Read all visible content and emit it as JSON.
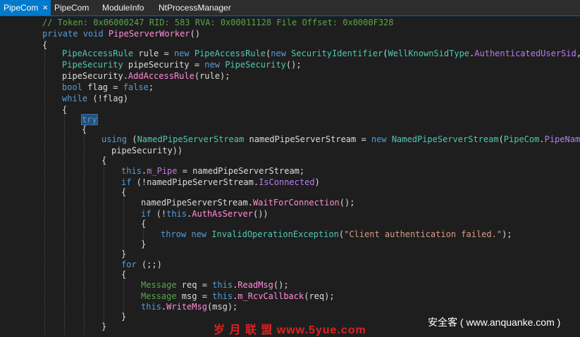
{
  "tabs": [
    {
      "label": "PipeCom",
      "active": true,
      "close": "×"
    },
    {
      "label": "PipeCom",
      "active": false
    },
    {
      "label": "ModuleInfo",
      "active": false
    },
    {
      "label": "NtProcessManager",
      "active": false
    }
  ],
  "code": {
    "comment": "// Token: 0x06000247 RID: 583 RVA: 0x00011128 File Offset: 0x0000F328",
    "try_keyword": "try",
    "exception_message": "\"Client authentication failed.\""
  },
  "watermark": {
    "left": "岁 月 联 盟  www.5yue.com",
    "right": "安全客 ( www.anquanke.com )"
  },
  "colors": {
    "tab_active": "#007acc",
    "editor_bg": "#1e1e1e",
    "keyword": "#569cd6",
    "type": "#4ec9b0",
    "method": "#ff8cd8",
    "comment": "#57a64a",
    "string": "#d69d85"
  }
}
